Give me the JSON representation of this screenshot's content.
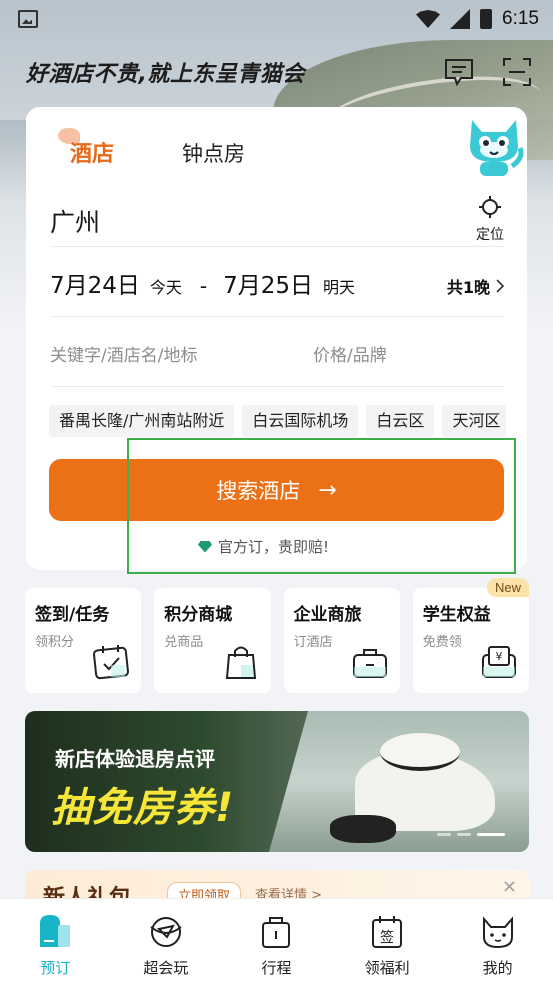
{
  "status_bar": {
    "time": "6:15"
  },
  "header": {
    "slogan": "好酒店不贵,就上东呈青猫会",
    "icons": [
      "message-icon",
      "scan-icon"
    ]
  },
  "tabs": [
    {
      "label": "酒店",
      "active": true
    },
    {
      "label": "钟点房",
      "active": false
    }
  ],
  "search": {
    "city": "广州",
    "locate_label": "定位",
    "checkin_date": "7月24日",
    "checkin_day": "今天",
    "separator": "-",
    "checkout_date": "7月25日",
    "checkout_day": "明天",
    "nights": "共1晚",
    "keyword_placeholder": "关键字/酒店名/地标",
    "price_placeholder": "价格/品牌",
    "chips": [
      "番禺长隆/广州南站附近",
      "白云国际机场",
      "白云区",
      "天河区"
    ],
    "button_label": "搜索酒店",
    "button_arrow": "→",
    "guarantee": "官方订，贵即赔!"
  },
  "quick_entries": [
    {
      "title": "签到/任务",
      "subtitle": "领积分",
      "icon": "calendar-check-icon"
    },
    {
      "title": "积分商城",
      "subtitle": "兑商品",
      "icon": "shopping-bag-icon"
    },
    {
      "title": "企业商旅",
      "subtitle": "订酒店",
      "icon": "briefcase-icon"
    },
    {
      "title": "学生权益",
      "subtitle": "免费领",
      "icon": "voucher-icon",
      "badge": "New"
    }
  ],
  "banner": {
    "line1": "新店体验退房点评",
    "line2": "抽免房券!"
  },
  "newbie": {
    "title": "新人礼包",
    "pill": "立即领取",
    "link": "查看详情 >",
    "close": "×"
  },
  "bottom_nav": [
    {
      "label": "预订",
      "active": true,
      "icon": "booking-icon"
    },
    {
      "label": "超会玩",
      "active": false,
      "icon": "play-icon"
    },
    {
      "label": "行程",
      "active": false,
      "icon": "trip-icon"
    },
    {
      "label": "领福利",
      "active": false,
      "icon": "sign-in-icon"
    },
    {
      "label": "我的",
      "active": false,
      "icon": "cat-profile-icon"
    }
  ],
  "colors": {
    "accent": "#ec7116",
    "nav_active": "#18b5c9",
    "highlight": "#3fae4a"
  }
}
